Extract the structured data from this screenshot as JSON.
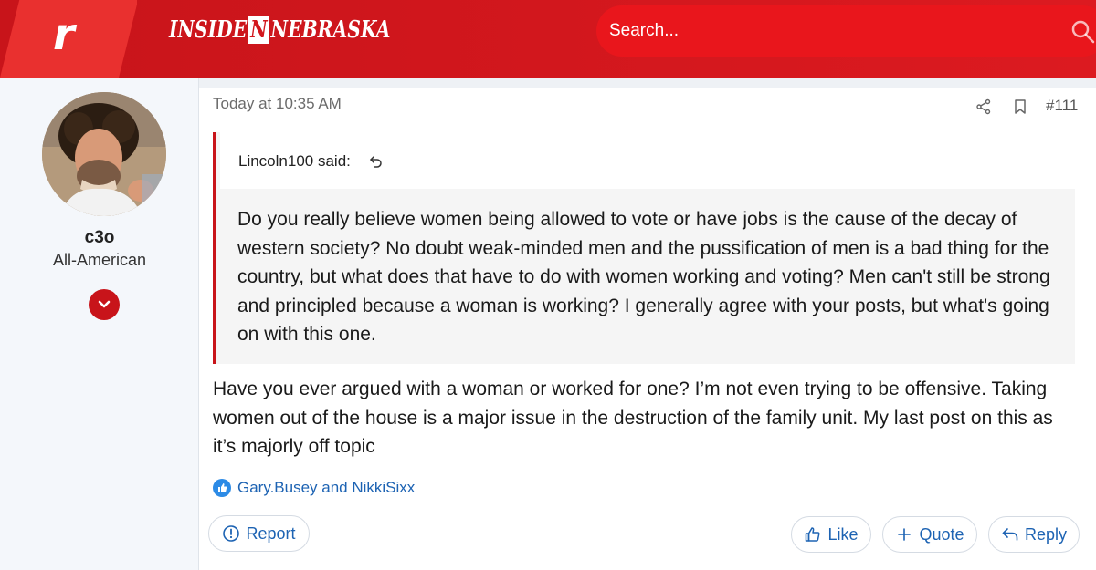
{
  "header": {
    "logo_letter": "r",
    "brand_left": "INSIDE",
    "brand_mid": "N",
    "brand_right": "NEBRASKA",
    "search_placeholder": "Search..."
  },
  "user": {
    "name": "c3o",
    "title": "All-American"
  },
  "post": {
    "timestamp": "Today at 10:35 AM",
    "number": "#111",
    "quote": {
      "author": "Lincoln100 said:",
      "text": "Do you really believe women being allowed to vote or have jobs is the cause of the decay of western society? No doubt weak-minded men and the pussification of men is a bad thing for the country, but what does that have to do with women working and voting? Men can't still be strong and principled because a woman is working? I generally agree with your posts, but what's going on with this one."
    },
    "body": "Have you ever argued with a woman or worked for one? I’m not even trying to be offensive. Taking women out of the house is a major issue in the destruction of the family unit. My last post on this as it’s majorly off topic",
    "reactions": "Gary.Busey and NikkiSixx",
    "actions": {
      "report": "Report",
      "like": "Like",
      "quote": "Quote",
      "reply": "Reply"
    }
  },
  "colors": {
    "brand_red": "#d2161c",
    "link_blue": "#1d63b3",
    "quote_border": "#c8141a"
  }
}
